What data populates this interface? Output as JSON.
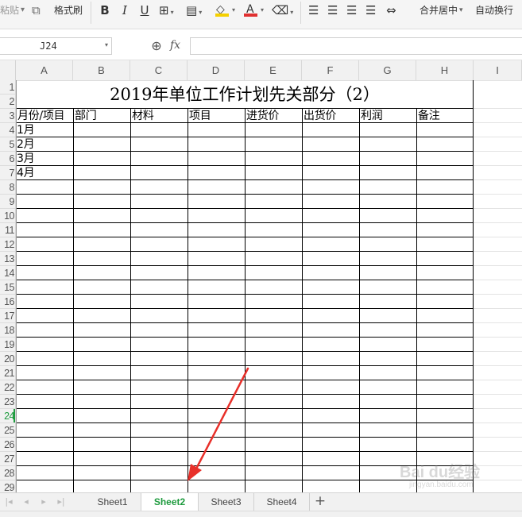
{
  "ribbon": {
    "paste_label": "粘贴",
    "format_painter_label": "格式刷",
    "bold_glyph": "B",
    "italic_glyph": "I",
    "underline_glyph": "U",
    "merge_center_label": "合并居中",
    "wrap_text_label": "自动换行",
    "font_color": "#e03030",
    "fill_color": "#f5d000"
  },
  "formula_bar": {
    "name_box_value": "J24",
    "fx_label": "fx",
    "formula_value": ""
  },
  "columns": [
    "A",
    "B",
    "C",
    "D",
    "E",
    "F",
    "G",
    "H",
    "I"
  ],
  "rows": [
    "1",
    "2",
    "3",
    "4",
    "5",
    "6",
    "7",
    "8",
    "9",
    "10",
    "11",
    "12",
    "13",
    "14",
    "15",
    "16",
    "17",
    "18",
    "19",
    "20",
    "21",
    "22",
    "23",
    "24",
    "25",
    "26",
    "27",
    "28",
    "29"
  ],
  "active_row": "24",
  "sheet": {
    "title": "2019年单位工作计划先关部分（2）",
    "headers": [
      "月份/项目",
      "部门",
      "材料",
      "项目",
      "进货价",
      "出货价",
      "利润",
      "备注"
    ],
    "months": [
      "1月",
      "2月",
      "3月",
      "4月"
    ]
  },
  "tabs": [
    "Sheet1",
    "Sheet2",
    "Sheet3",
    "Sheet4"
  ],
  "active_tab": "Sheet2",
  "add_sheet_glyph": "+",
  "watermark": {
    "text": "Bai du经验",
    "sub": "jingyan.baidu.com"
  },
  "colors": {
    "accent_green": "#1e9b3e",
    "annotation_arrow": "#e8302a"
  },
  "icons": [
    "paste-icon",
    "copy-icon",
    "format-painter-icon",
    "border-icon",
    "conditional-format-icon",
    "fill-color-icon",
    "font-color-icon",
    "eraser-icon",
    "align-left-icon",
    "align-center-icon",
    "align-right-icon",
    "justify-icon",
    "distribute-icon",
    "zoom-icon",
    "add-sheet-icon"
  ]
}
